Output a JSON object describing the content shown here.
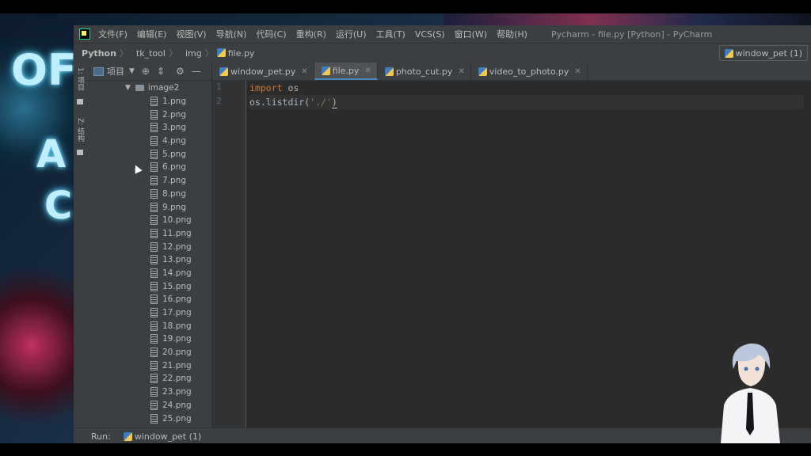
{
  "window": {
    "title": "Pycharm - file.py [Python] - PyCharm"
  },
  "menu": [
    "文件(F)",
    "编辑(E)",
    "视图(V)",
    "导航(N)",
    "代码(C)",
    "重构(R)",
    "运行(U)",
    "工具(T)",
    "VCS(S)",
    "窗口(W)",
    "帮助(H)"
  ],
  "breadcrumb": {
    "root": "Python",
    "folder1": "tk_tool",
    "folder2": "img",
    "file": "file.py"
  },
  "run_config": "window_pet (1)",
  "left_strip": {
    "project_tab": "1: 项目",
    "structure_tab": "Z: 结构"
  },
  "project_panel": {
    "title": "项目",
    "folder": "image2",
    "files": [
      "1.png",
      "2.png",
      "3.png",
      "4.png",
      "5.png",
      "6.png",
      "7.png",
      "8.png",
      "9.png",
      "10.png",
      "11.png",
      "12.png",
      "13.png",
      "14.png",
      "15.png",
      "16.png",
      "17.png",
      "18.png",
      "19.png",
      "20.png",
      "21.png",
      "22.png",
      "23.png",
      "24.png",
      "25.png"
    ]
  },
  "tabs": [
    {
      "label": "window_pet.py",
      "active": false
    },
    {
      "label": "file.py",
      "active": true
    },
    {
      "label": "photo_cut.py",
      "active": false
    },
    {
      "label": "video_to_photo.py",
      "active": false
    }
  ],
  "code": {
    "line_numbers": [
      "1",
      "2"
    ],
    "line1_keyword": "import",
    "line1_rest": " os",
    "line2_pre": "os.listdir(",
    "line2_str": "'./'",
    "line2_close": ")"
  },
  "status": {
    "run_label": "Run:",
    "run_tab": "window_pet (1)"
  },
  "wallpaper_neon": [
    "OF",
    "A",
    "C"
  ],
  "colors": {
    "editor_bg": "#2b2b2b",
    "panel_bg": "#3c3f41",
    "keyword": "#cc7832",
    "string": "#6a8759",
    "text": "#a9b7c6"
  }
}
